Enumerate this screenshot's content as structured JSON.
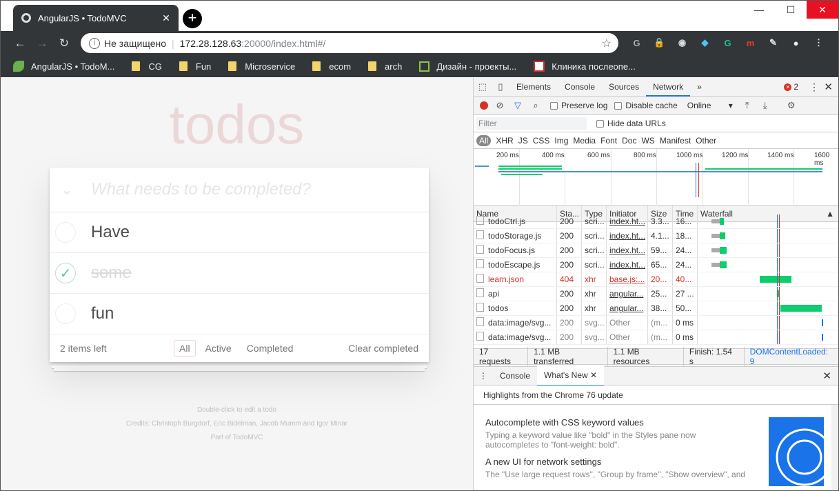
{
  "browser": {
    "tab_title": "AngularJS • TodoMVC",
    "tab_close": "✕",
    "new_tab": "+",
    "window_controls": [
      "—",
      "☐",
      "✕"
    ],
    "security_label": "Не защищено",
    "url_host": "172.28.128.63",
    "url_path": ":20000/index.html#/",
    "extensions": [
      "G",
      "🔒",
      "◉",
      "◆",
      "G",
      "m",
      "✎",
      "●",
      "⋮"
    ]
  },
  "bookmarks": [
    "AngularJS • TodoM...",
    "CG",
    "Fun",
    "Microservice",
    "ecom",
    "arch",
    "Дизайн - проекты...",
    "Клиника послеопе..."
  ],
  "todo": {
    "title": "todos",
    "placeholder": "What needs to be completed?",
    "items": [
      {
        "label": "Have",
        "done": false
      },
      {
        "label": "some",
        "done": true
      },
      {
        "label": "fun",
        "done": false
      }
    ],
    "items_left": "2 items left",
    "filters": [
      "All",
      "Active",
      "Completed"
    ],
    "selected_filter": "All",
    "clear_completed": "Clear completed",
    "info": [
      "Double-click to edit a todo",
      "Credits: Christoph Burgdorf, Eric Bidelman, Jacob Mumm and Igor Minar",
      "Part of TodoMVC"
    ]
  },
  "devtools": {
    "tabs": [
      "Elements",
      "Console",
      "Sources",
      "Network"
    ],
    "active_tab": "Network",
    "more": "»",
    "error_count": "2",
    "preserve_log": "Preserve log",
    "disable_cache": "Disable cache",
    "throttle": "Online",
    "filter_placeholder": "Filter",
    "hide_data_urls": "Hide data URLs",
    "types": [
      "All",
      "XHR",
      "JS",
      "CSS",
      "Img",
      "Media",
      "Font",
      "Doc",
      "WS",
      "Manifest",
      "Other"
    ],
    "timeline_ticks": [
      "200 ms",
      "400 ms",
      "600 ms",
      "800 ms",
      "1000 ms",
      "1200 ms",
      "1400 ms",
      "1600 ms"
    ],
    "columns": [
      "Name",
      "Sta...",
      "Type",
      "Initiator",
      "Size",
      "Time",
      "Waterfall"
    ],
    "rows": [
      {
        "name": "todoCtrl.js",
        "status": "200",
        "type": "scri...",
        "initiator": "index.ht...",
        "size": "3.3...",
        "time": "16..."
      },
      {
        "name": "todoStorage.js",
        "status": "200",
        "type": "scri...",
        "initiator": "index.ht...",
        "size": "4.1...",
        "time": "18..."
      },
      {
        "name": "todoFocus.js",
        "status": "200",
        "type": "scri...",
        "initiator": "index.ht...",
        "size": "59...",
        "time": "24..."
      },
      {
        "name": "todoEscape.js",
        "status": "200",
        "type": "scri...",
        "initiator": "index.ht...",
        "size": "65...",
        "time": "24..."
      },
      {
        "name": "learn.json",
        "status": "404",
        "type": "xhr",
        "initiator": "base.js:...",
        "size": "20...",
        "time": "40..."
      },
      {
        "name": "api",
        "status": "200",
        "type": "xhr",
        "initiator": "angular...",
        "size": "25...",
        "time": "27 ..."
      },
      {
        "name": "todos",
        "status": "200",
        "type": "xhr",
        "initiator": "angular...",
        "size": "38...",
        "time": "50..."
      },
      {
        "name": "data:image/svg...",
        "status": "200",
        "type": "svg...",
        "initiator": "Other",
        "size": "(m...",
        "time": "0 ms"
      },
      {
        "name": "data:image/svg...",
        "status": "200",
        "type": "svg...",
        "initiator": "Other",
        "size": "(m...",
        "time": "0 ms"
      }
    ],
    "summary": [
      "17 requests",
      "1.1 MB transferred",
      "1.1 MB resources",
      "Finish: 1.54 s",
      "DOMContentLoaded: 9"
    ],
    "drawer_tabs": [
      "Console",
      "What's New"
    ],
    "drawer_active": "What's New",
    "drawer_subtitle": "Highlights from the Chrome 76 update",
    "news": [
      {
        "title": "Autocomplete with CSS keyword values",
        "body": "Typing a keyword value like \"bold\" in the Styles pane now autocompletes to \"font-weight: bold\"."
      },
      {
        "title": "A new UI for network settings",
        "body": "The \"Use large request rows\", \"Group by frame\", \"Show overview\", and \"Capture screenshots\" options have moved to"
      }
    ]
  }
}
